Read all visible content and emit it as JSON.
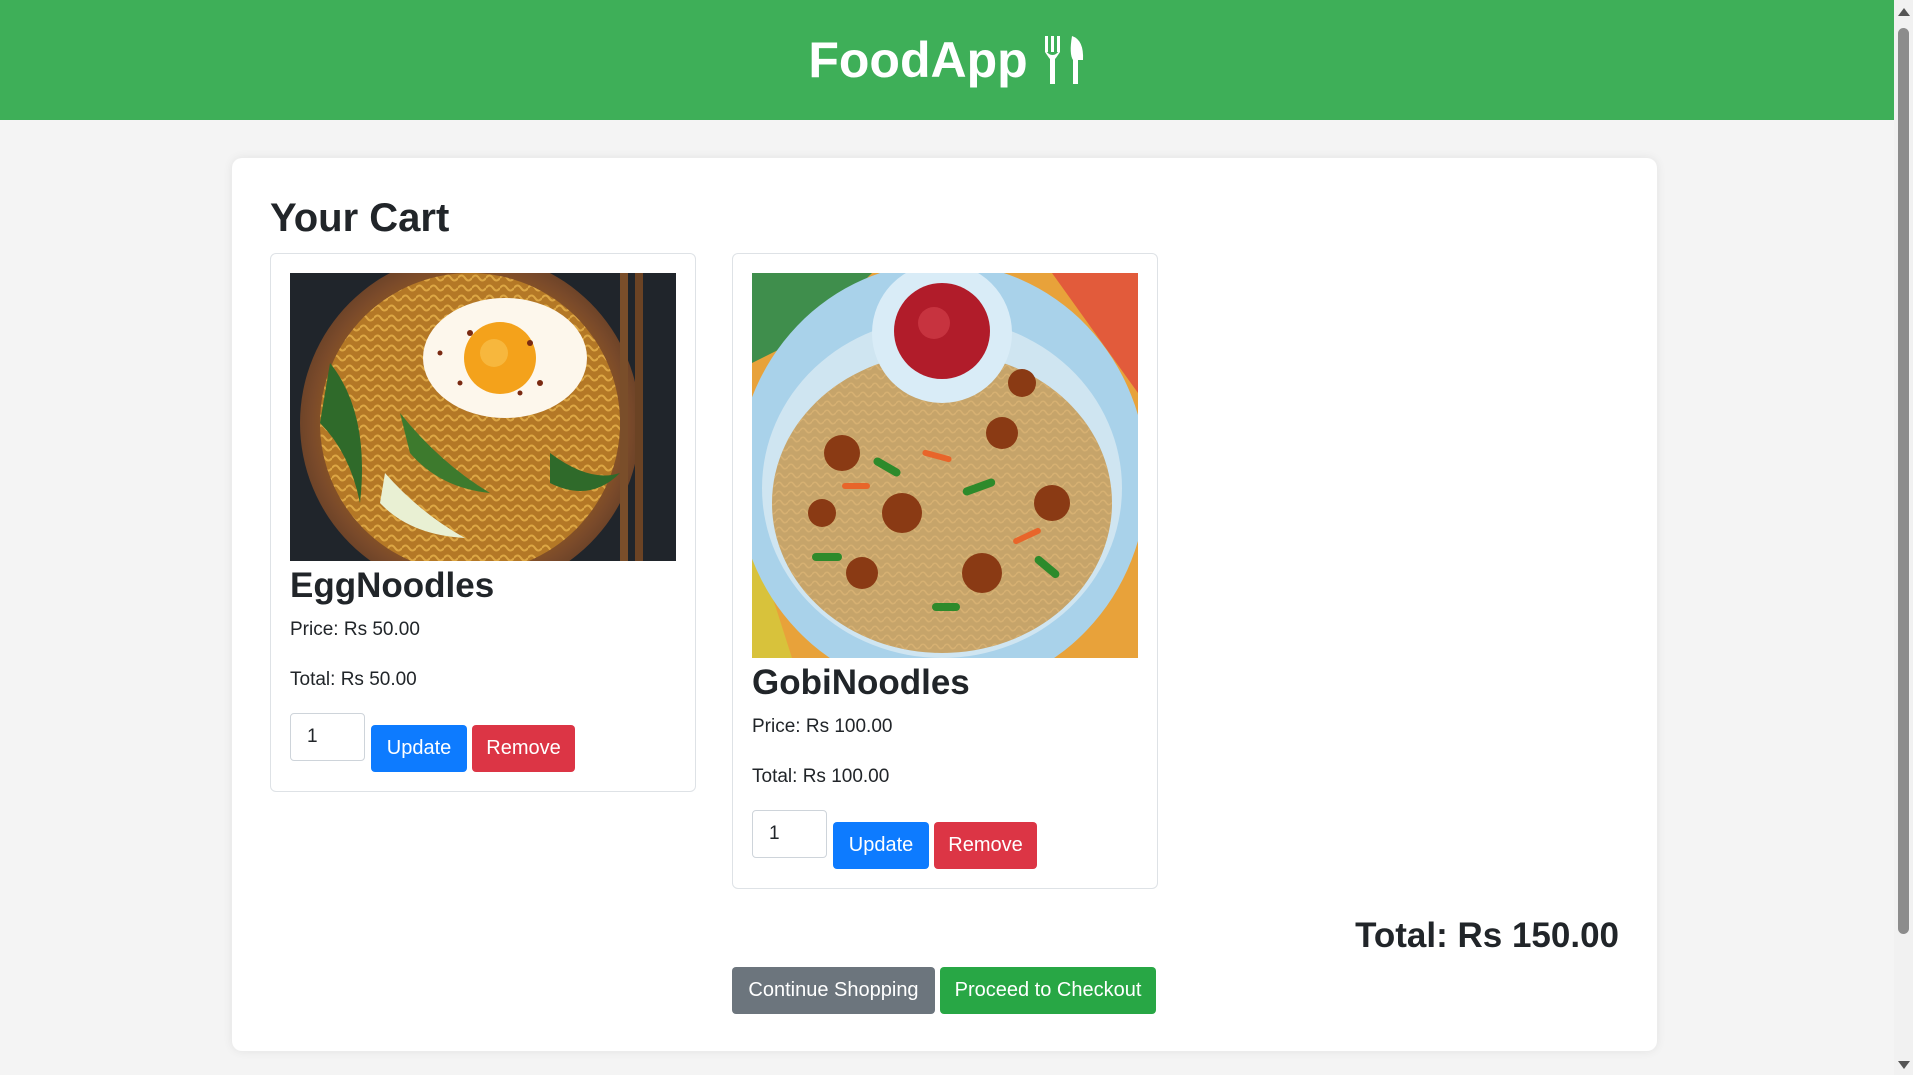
{
  "header": {
    "brand": "FoodApp"
  },
  "cart": {
    "title": "Your Cart",
    "items": [
      {
        "name": "EggNoodles",
        "price_label": "Price: Rs 50.00",
        "total_label": "Total: Rs 50.00",
        "quantity": "1",
        "update_label": "Update",
        "remove_label": "Remove"
      },
      {
        "name": "GobiNoodles",
        "price_label": "Price: Rs 100.00",
        "total_label": "Total: Rs 100.00",
        "quantity": "1",
        "update_label": "Update",
        "remove_label": "Remove"
      }
    ],
    "grand_total": "Total: Rs 150.00",
    "continue_label": "Continue Shopping",
    "checkout_label": "Proceed to Checkout"
  },
  "colors": {
    "header_bg": "#3eaf58",
    "update": "#0d7bff",
    "remove": "#dc3545",
    "continue": "#6c757d",
    "checkout": "#28a745"
  },
  "icons": {
    "brand_icon": "utensils-icon"
  }
}
